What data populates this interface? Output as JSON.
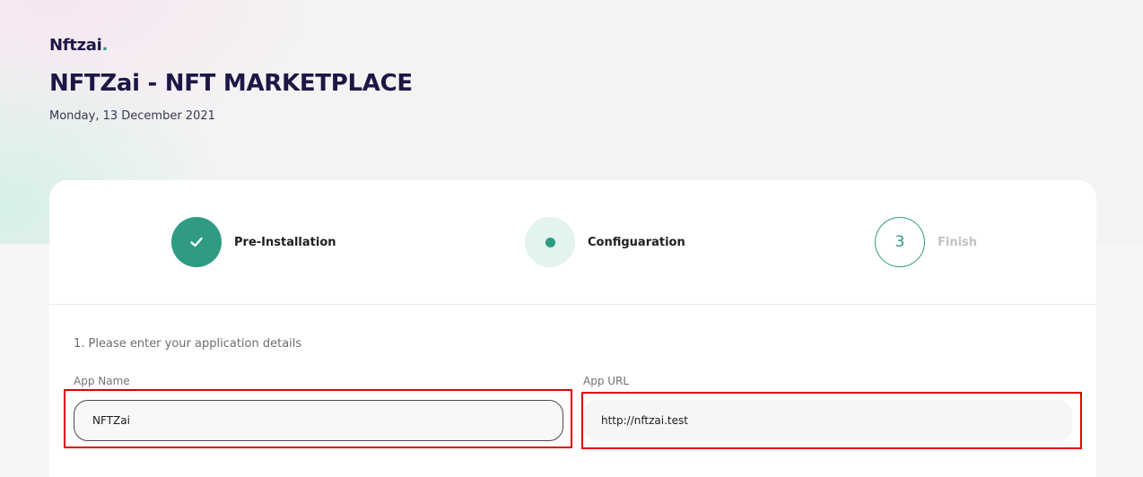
{
  "brand": {
    "name": "Nftzai",
    "dot": "."
  },
  "header": {
    "title": "NFTZai - NFT MARKETPLACE",
    "date": "Monday, 13 December 2021"
  },
  "steps": [
    {
      "label": "Pre-Installation",
      "state": "done",
      "icon": "check-icon"
    },
    {
      "label": "Configuaration",
      "state": "active",
      "icon": "dot-icon"
    },
    {
      "label": "Finish",
      "state": "pending",
      "number": "3"
    }
  ],
  "form": {
    "section_heading": "1. Please enter your application details",
    "app_name": {
      "label": "App Name",
      "value": "NFTZai"
    },
    "app_url": {
      "label": "App URL",
      "value": "http://nftzai.test"
    }
  },
  "colors": {
    "accent": "#2f9b83",
    "heading": "#1d1746",
    "highlight": "#e10000"
  }
}
